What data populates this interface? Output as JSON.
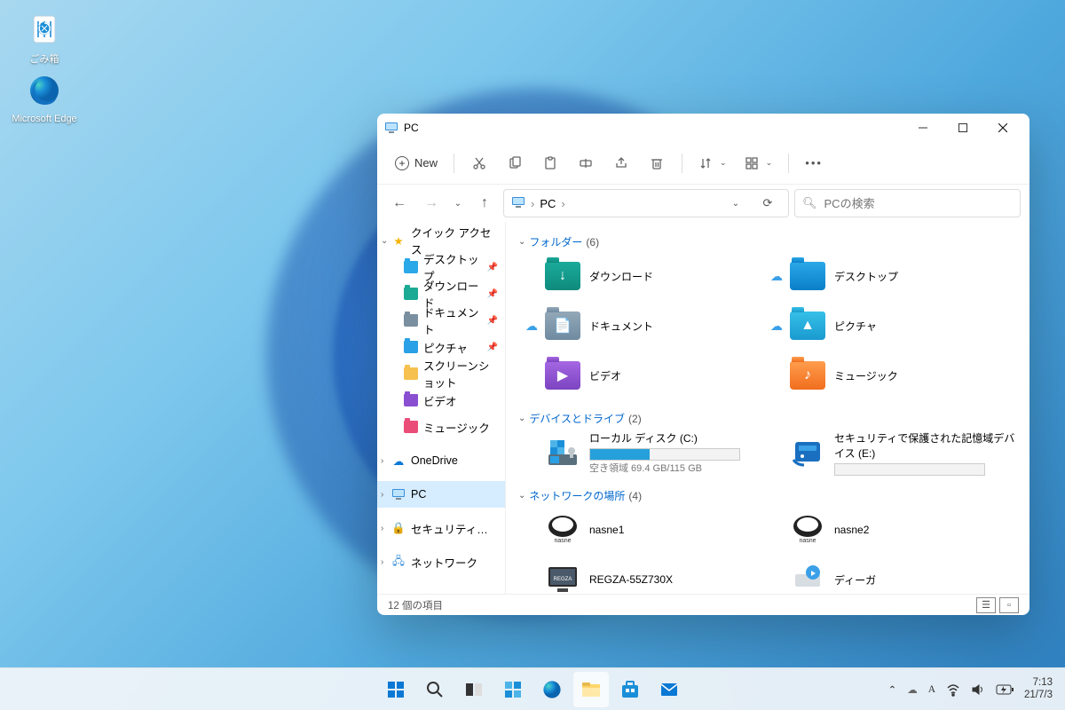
{
  "desktop": {
    "icons": [
      {
        "name": "recycle-bin",
        "label": "ごみ箱"
      },
      {
        "name": "microsoft-edge",
        "label": "Microsoft Edge"
      }
    ]
  },
  "window": {
    "title": "PC",
    "toolbar": {
      "new": "New",
      "buttons": [
        "cut",
        "copy",
        "paste",
        "rename",
        "share",
        "delete"
      ],
      "sort": "sort",
      "view": "view",
      "more": "more"
    },
    "address": {
      "crumb1": "PC",
      "sep": "›"
    },
    "search": {
      "placeholder": "PCの検索"
    },
    "sidebar": {
      "quick_access": "クイック アクセス",
      "items": [
        {
          "label": "デスクトップ",
          "icon": "desktop",
          "color": "#2aa8e8",
          "pinned": true
        },
        {
          "label": "ダウンロード",
          "icon": "downloads",
          "color": "#1caa95",
          "pinned": true
        },
        {
          "label": "ドキュメント",
          "icon": "document",
          "color": "#7a8fa0",
          "pinned": true
        },
        {
          "label": "ピクチャ",
          "icon": "pictures",
          "color": "#2aa0e6",
          "pinned": true
        },
        {
          "label": "スクリーンショット",
          "icon": "folder",
          "color": "#f6c14f",
          "pinned": false
        },
        {
          "label": "ビデオ",
          "icon": "video",
          "color": "#8a4fd1",
          "pinned": false
        },
        {
          "label": "ミュージック",
          "icon": "music",
          "color": "#ea4e78",
          "pinned": false
        }
      ],
      "onedrive": "OneDrive",
      "pc": "PC",
      "secured": "セキュリティで保護された",
      "network": "ネットワーク"
    },
    "groups": {
      "folders": {
        "label": "フォルダー",
        "count": "(6)"
      },
      "drives": {
        "label": "デバイスとドライブ",
        "count": "(2)"
      },
      "network": {
        "label": "ネットワークの場所",
        "count": "(4)"
      }
    },
    "folders": [
      {
        "label": "ダウンロード",
        "color": "teal",
        "glyph": "↓",
        "cloud": false
      },
      {
        "label": "デスクトップ",
        "color": "blue",
        "glyph": "",
        "cloud": true
      },
      {
        "label": "ドキュメント",
        "color": "gray",
        "glyph": "📄",
        "cloud": true
      },
      {
        "label": "ピクチャ",
        "color": "cyan",
        "glyph": "▲",
        "cloud": true
      },
      {
        "label": "ビデオ",
        "color": "violet",
        "glyph": "▶",
        "cloud": false
      },
      {
        "label": "ミュージック",
        "color": "orange",
        "glyph": "♪",
        "cloud": false
      }
    ],
    "drives": [
      {
        "label": "ローカル ディスク (C:)",
        "sub": "空き領域 69.4 GB/115 GB",
        "fill": 40
      },
      {
        "label": "セキュリティで保護された記憶域デバイス (E:)",
        "sub": "",
        "fill": 0
      }
    ],
    "netloc": [
      {
        "label": "nasne1",
        "type": "nasne"
      },
      {
        "label": "nasne2",
        "type": "nasne"
      },
      {
        "label": "REGZA-55Z730X",
        "type": "tv"
      },
      {
        "label": "ディーガ",
        "type": "recorder"
      }
    ],
    "status": "12 個の項目"
  },
  "taskbar": {
    "icons": [
      "start",
      "search",
      "taskview",
      "widgets",
      "edge",
      "explorer",
      "store",
      "mail"
    ],
    "active": "explorer",
    "tray": {
      "ime": "A",
      "time": "7:13",
      "date": "21/7/3"
    }
  }
}
